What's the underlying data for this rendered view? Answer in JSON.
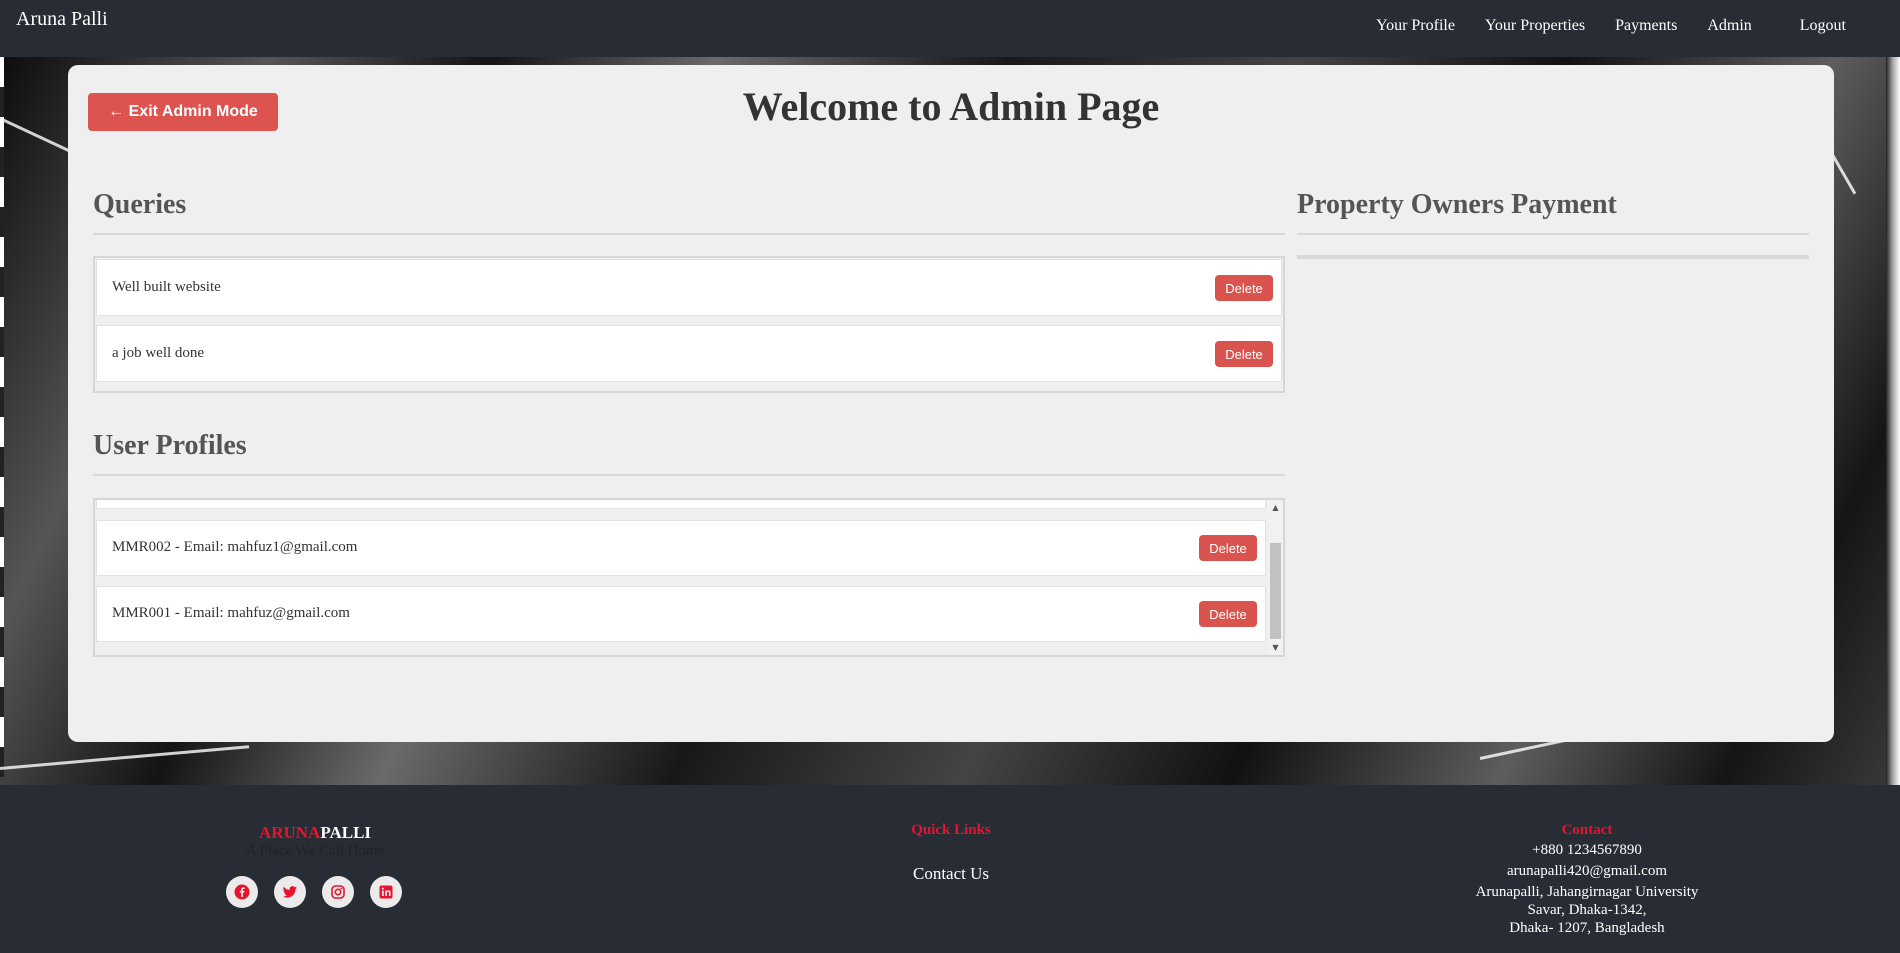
{
  "navbar": {
    "brand": "Aruna Palli",
    "links": [
      "Your Profile",
      "Your Properties",
      "Payments",
      "Admin",
      "Logout"
    ]
  },
  "admin": {
    "exit_button": "← Exit Admin Mode",
    "title": "Welcome to Admin Page"
  },
  "queries": {
    "title": "Queries",
    "items": [
      {
        "text": "Well built website",
        "action": "Delete"
      },
      {
        "text": "a job well done",
        "action": "Delete"
      }
    ]
  },
  "user_profiles": {
    "title": "User Profiles",
    "items": [
      {
        "text": "MMR002 - Email: mahfuz1@gmail.com",
        "action": "Delete"
      },
      {
        "text": "MMR001 - Email: mahfuz@gmail.com",
        "action": "Delete"
      }
    ]
  },
  "payments": {
    "title": "Property Owners Payment"
  },
  "footer": {
    "brand_red": "ARUNA",
    "brand_white": "PALLI",
    "tagline": "A Place We Call Home",
    "quick_links_title": "Quick Links",
    "quick_links": [
      "Contact Us"
    ],
    "contact_title": "Contact",
    "contact_lines": [
      "+880 1234567890",
      "arunapalli420@gmail.com",
      "Arunapalli, Jahangirnagar University",
      "Savar, Dhaka-1342,",
      "Dhaka- 1207, Bangladesh"
    ],
    "socials": [
      "facebook-icon",
      "twitter-icon",
      "instagram-icon",
      "linkedin-icon"
    ]
  },
  "colors": {
    "nav_bg": "#282c34",
    "accent_red": "#d9534f",
    "brand_red": "#e8132f",
    "card_bg": "#efefef"
  }
}
